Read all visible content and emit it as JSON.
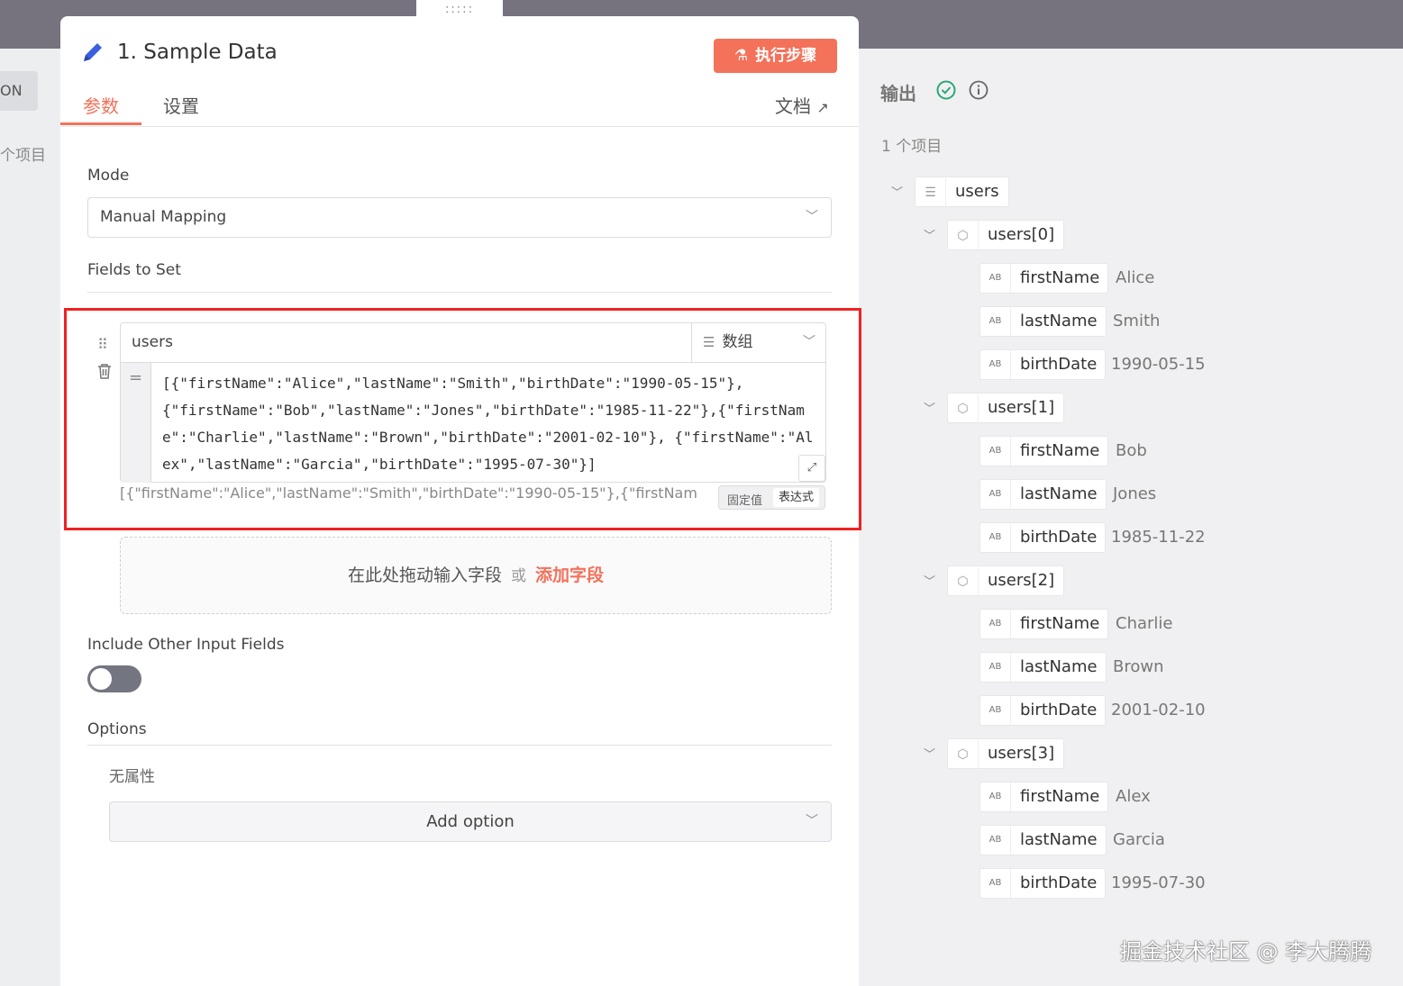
{
  "left_peek": {
    "chip_label": "ON",
    "count_label": "个项目"
  },
  "drag_tab": {
    "label": ":::::"
  },
  "node": {
    "title": "1. Sample Data",
    "execute_label": "执行步骤",
    "tabs": [
      "参数",
      "设置"
    ],
    "docs_label": "文档"
  },
  "params": {
    "mode_label": "Mode",
    "mode_value": "Manual Mapping",
    "fields_label": "Fields to Set",
    "field": {
      "name": "users",
      "type": "数组",
      "value": "[{\"firstName\":\"Alice\",\"lastName\":\"Smith\",\"birthDate\":\"1990-05-15\"},\n{\"firstName\":\"Bob\",\"lastName\":\"Jones\",\"birthDate\":\"1985-11-22\"},{\"firstName\":\"Charlie\",\"lastName\":\"Brown\",\"birthDate\":\"2001-02-10\"}, {\"firstName\":\"Alex\",\"lastName\":\"Garcia\",\"birthDate\":\"1995-07-30\"}]",
      "preview": "[{\"firstName\":\"Alice\",\"lastName\":\"Smith\",\"birthDate\":\"1990-05-15\"},{\"firstNam",
      "mode_fixed": "固定值",
      "mode_expression": "表达式"
    },
    "drop_hint": "在此处拖动输入字段",
    "drop_or": "或",
    "add_field": "添加字段",
    "include_label": "Include Other Input Fields",
    "include_on": false,
    "options_label": "Options",
    "no_props": "无属性",
    "add_option": "Add option"
  },
  "output": {
    "title": "输出",
    "count": "1 个项目",
    "root": "users",
    "items": [
      {
        "label": "users[0]",
        "fields": [
          {
            "key": "firstName",
            "value": "Alice"
          },
          {
            "key": "lastName",
            "value": "Smith"
          },
          {
            "key": "birthDate",
            "value": "1990-05-15"
          }
        ]
      },
      {
        "label": "users[1]",
        "fields": [
          {
            "key": "firstName",
            "value": "Bob"
          },
          {
            "key": "lastName",
            "value": "Jones"
          },
          {
            "key": "birthDate",
            "value": "1985-11-22"
          }
        ]
      },
      {
        "label": "users[2]",
        "fields": [
          {
            "key": "firstName",
            "value": "Charlie"
          },
          {
            "key": "lastName",
            "value": "Brown"
          },
          {
            "key": "birthDate",
            "value": "2001-02-10"
          }
        ]
      },
      {
        "label": "users[3]",
        "fields": [
          {
            "key": "firstName",
            "value": "Alex"
          },
          {
            "key": "lastName",
            "value": "Garcia"
          },
          {
            "key": "birthDate",
            "value": "1995-07-30"
          }
        ]
      }
    ]
  },
  "watermark": "掘金技术社区 @ 李大腾腾",
  "colors": {
    "accent": "#f4715a",
    "success": "#2aa876",
    "highlight_border": "#ee2222"
  }
}
